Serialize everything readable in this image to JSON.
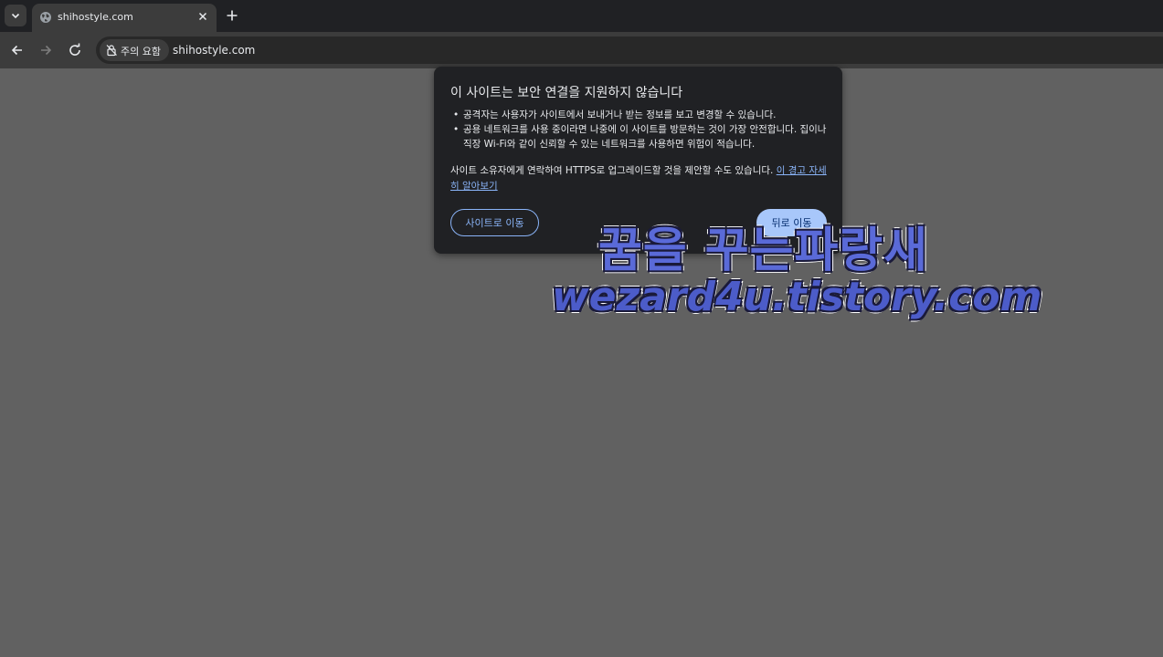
{
  "tab": {
    "title": "shihostyle.com"
  },
  "omnibox": {
    "security_chip": "주의 요함",
    "url": "shihostyle.com"
  },
  "popup": {
    "title": "이 사이트는 보안 연결을 지원하지 않습니다",
    "bullets": [
      "공격자는 사용자가 사이트에서 보내거나 받는 정보를 보고 변경할 수 있습니다.",
      "공용 네트워크를 사용 중이라면 나중에 이 사이트를 방문하는 것이 가장 안전합니다. 집이나 직장 Wi-Fi와 같이 신뢰할 수 있는 네트워크를 사용하면 위험이 적습니다."
    ],
    "paragraph": "사이트 소유자에게 연락하여 HTTPS로 업그레이드할 것을 제안할 수도 있습니다. ",
    "learn_more_link": "이 경고 자세히 알아보기",
    "go_to_site_button": "사이트로 이동",
    "go_back_button": "뒤로 이동"
  },
  "watermark": {
    "line1": "꿈을 꾸는파랑새",
    "line2": "wezard4u.tistory.com"
  },
  "colors": {
    "page_bg": "#616161",
    "popup_bg": "#202124",
    "accent": "#8ab4f8",
    "primary_button": "#a8c7fa"
  }
}
